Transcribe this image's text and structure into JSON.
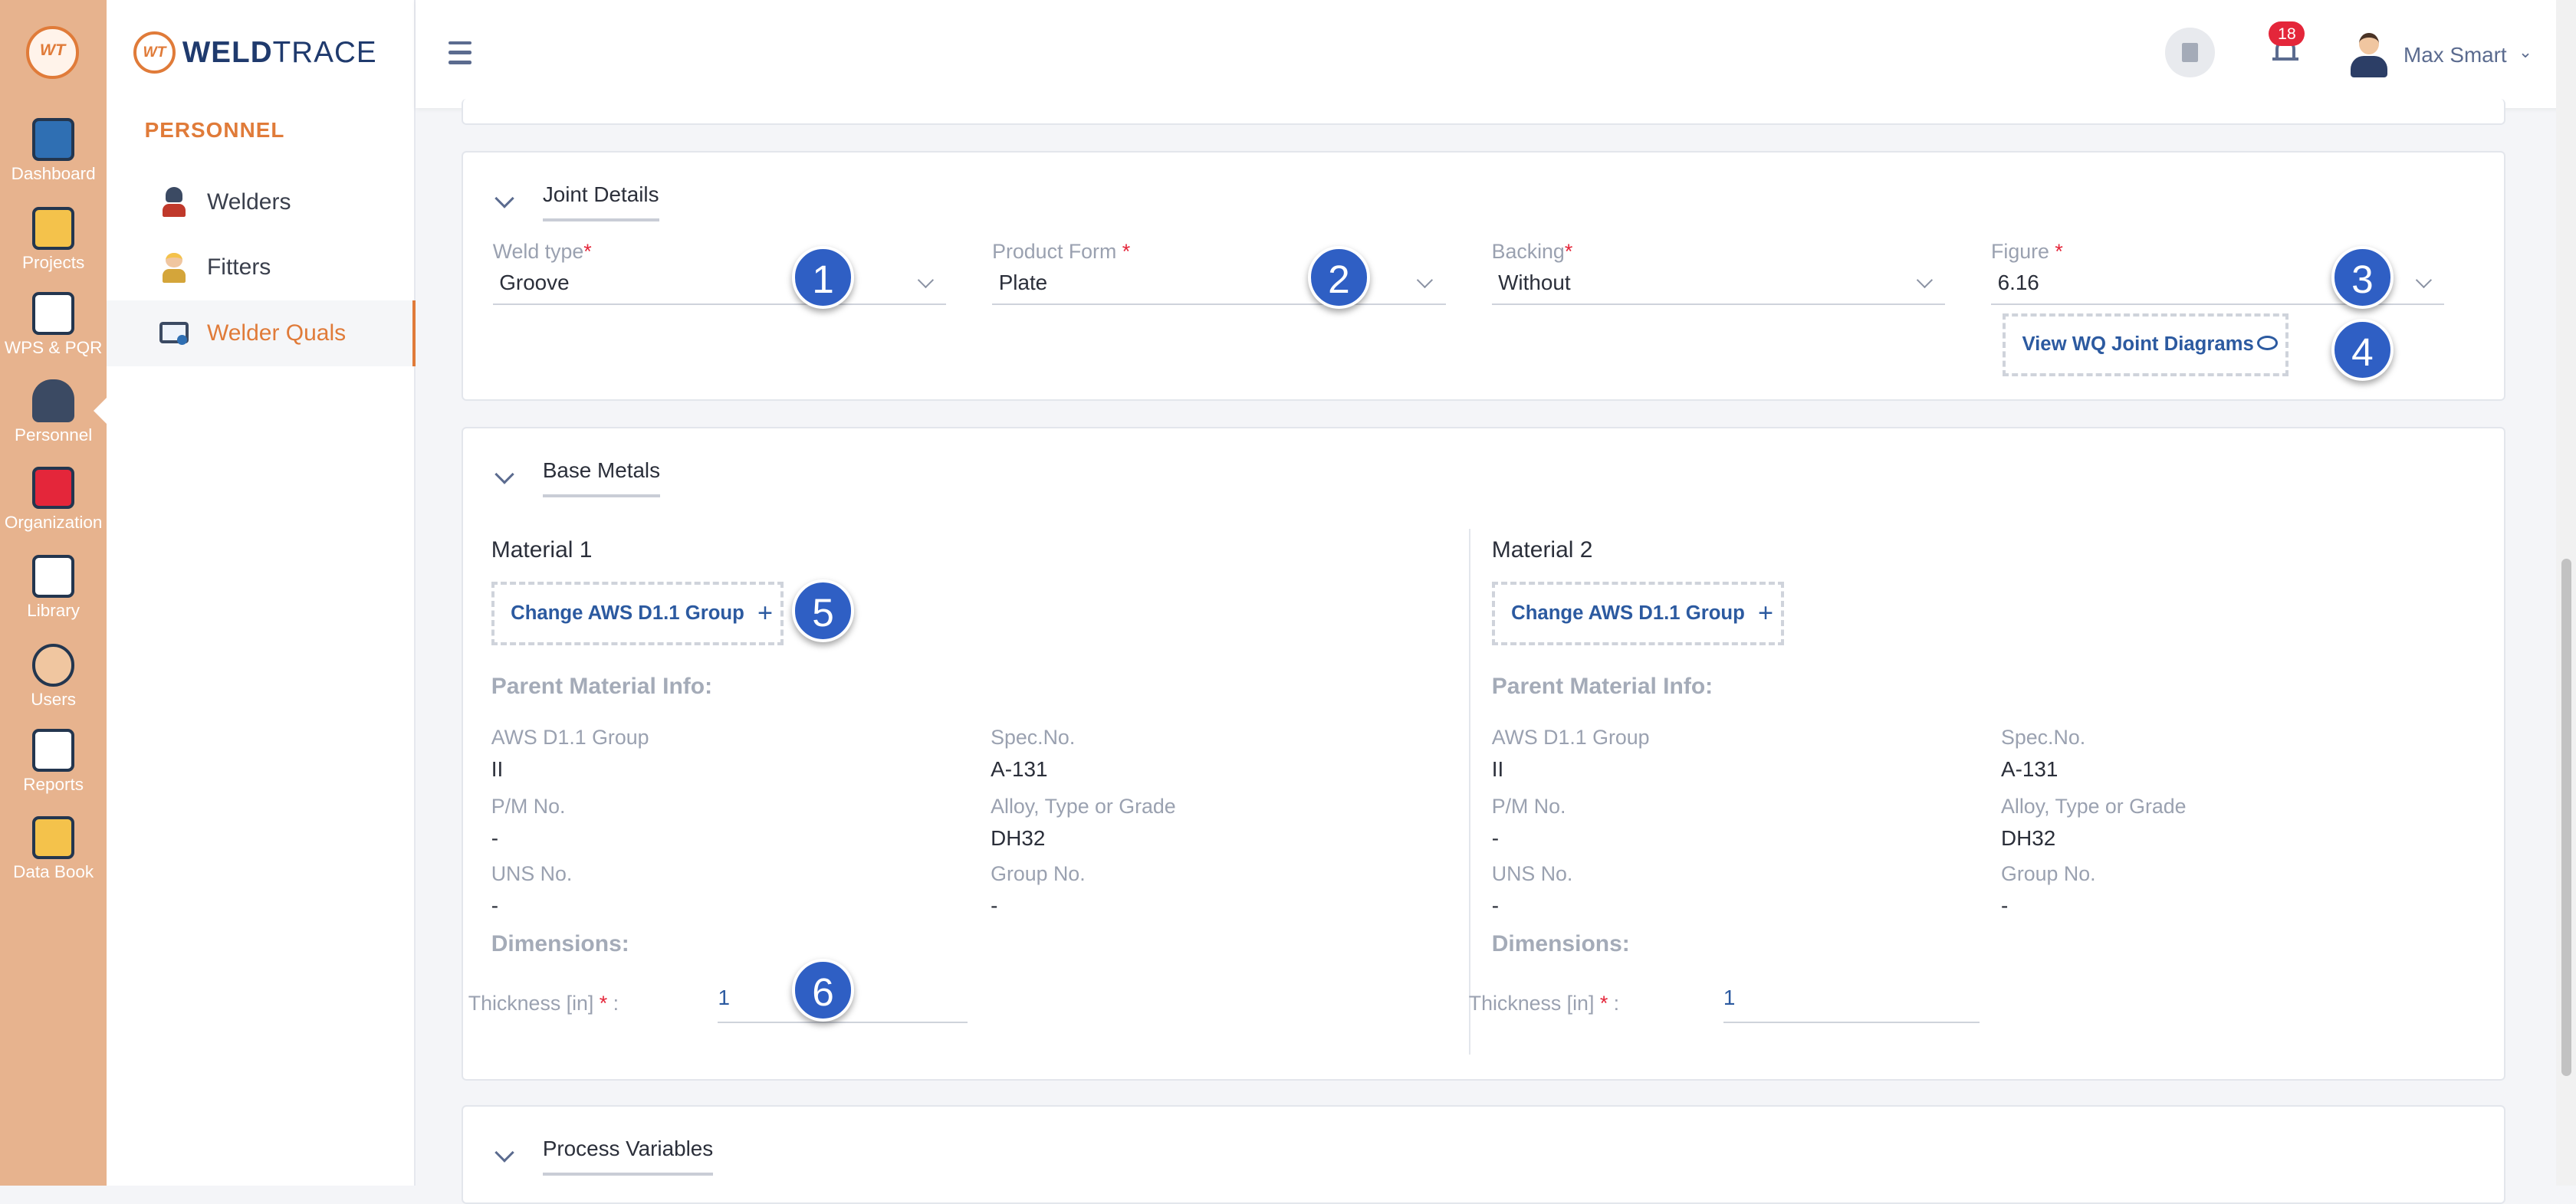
{
  "rail": {
    "items": [
      {
        "label": "Dashboard"
      },
      {
        "label": "Projects"
      },
      {
        "label": "WPS & PQR"
      },
      {
        "label": "Personnel"
      },
      {
        "label": "Organization"
      },
      {
        "label": "Library"
      },
      {
        "label": "Users"
      },
      {
        "label": "Reports"
      },
      {
        "label": "Data Book"
      }
    ]
  },
  "brand": {
    "mark": "WT",
    "name_bold": "WELD",
    "name_light": "TRACE"
  },
  "sidebar": {
    "section": "PERSONNEL",
    "items": [
      {
        "label": "Welders"
      },
      {
        "label": "Fitters"
      },
      {
        "label": "Welder Quals"
      }
    ]
  },
  "topbar": {
    "notification_count": "18",
    "user_name": "Max Smart"
  },
  "joint": {
    "title": "Joint Details",
    "weld_type": {
      "label": "Weld type",
      "value": "Groove"
    },
    "product_form": {
      "label": "Product Form",
      "value": "Plate"
    },
    "backing": {
      "label": "Backing",
      "value": "Without"
    },
    "figure": {
      "label": "Figure",
      "value": "6.16"
    },
    "view_diagrams": "View WQ Joint Diagrams"
  },
  "base_metals": {
    "title": "Base Metals",
    "materials": [
      {
        "title": "Material 1",
        "change_btn": "Change AWS D1.1 Group",
        "info_title": "Parent Material Info:",
        "aws_group_label": "AWS D1.1 Group",
        "aws_group": "II",
        "spec_label": "Spec.No.",
        "spec": "A-131",
        "pm_label": "P/M No.",
        "pm": "-",
        "alloy_label": "Alloy, Type or Grade",
        "alloy": "DH32",
        "uns_label": "UNS No.",
        "uns": "-",
        "group_label": "Group No.",
        "group": "-",
        "dimensions_title": "Dimensions:",
        "thickness_label": "Thickness [in]",
        "thickness": "1"
      },
      {
        "title": "Material 2",
        "change_btn": "Change AWS D1.1 Group",
        "info_title": "Parent Material Info:",
        "aws_group_label": "AWS D1.1 Group",
        "aws_group": "II",
        "spec_label": "Spec.No.",
        "spec": "A-131",
        "pm_label": "P/M No.",
        "pm": "-",
        "alloy_label": "Alloy, Type or Grade",
        "alloy": "DH32",
        "uns_label": "UNS No.",
        "uns": "-",
        "group_label": "Group No.",
        "group": "-",
        "dimensions_title": "Dimensions:",
        "thickness_label": "Thickness [in]",
        "thickness": "1"
      }
    ]
  },
  "process": {
    "title": "Process Variables"
  },
  "markers": [
    "1",
    "2",
    "3",
    "4",
    "5",
    "6"
  ],
  "colors": {
    "accent": "#e07b39",
    "rail": "#e7b38e",
    "link": "#2c5aa0",
    "marker": "#2f5fc4",
    "badge": "#e4263a"
  }
}
